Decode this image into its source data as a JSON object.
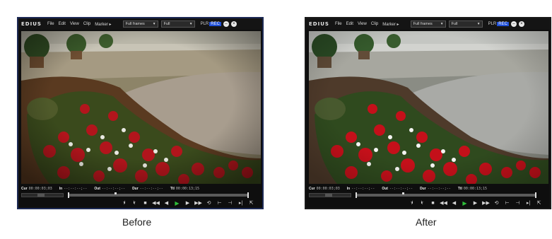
{
  "panels": {
    "before": {
      "logo": "EDIUS",
      "menu": [
        "File",
        "Edit",
        "View",
        "Clip",
        "Marker ▸"
      ],
      "dropdown_1": "Full frames",
      "dropdown_2": "Full",
      "plr_label": "PLR",
      "rec_label": "REC",
      "timecodes": [
        {
          "label": "Cur",
          "value": "00:00:03;03"
        },
        {
          "label": "In",
          "value": "--:--:--;--"
        },
        {
          "label": "Out",
          "value": "--:--:--;--"
        },
        {
          "label": "Dur",
          "value": "--:--:--;--"
        },
        {
          "label": "Ttl",
          "value": "00:00:13;15"
        }
      ],
      "caption": "Before"
    },
    "after": {
      "logo": "EDIUS",
      "menu": [
        "File",
        "Edit",
        "View",
        "Clip",
        "Marker ▸"
      ],
      "dropdown_1": "Full frames",
      "dropdown_2": "Full",
      "plr_label": "PLR",
      "rec_label": "REC",
      "timecodes": [
        {
          "label": "Cur",
          "value": "00:00:03;03"
        },
        {
          "label": "In",
          "value": "--:--:--;--"
        },
        {
          "label": "Out",
          "value": "--:--:--;--"
        },
        {
          "label": "Dur",
          "value": "--:--:--;--"
        },
        {
          "label": "Ttl",
          "value": "00:00:13;15"
        }
      ],
      "caption": "After"
    }
  },
  "colors": {
    "rec_accent": "#1f4fd6",
    "play_green": "#2fbf3a",
    "before_border": "#1d2a55"
  },
  "control_icons": [
    "mark-in-icon",
    "mark-out-icon",
    "stop-icon",
    "rewind-icon",
    "step-back-icon",
    "play-icon",
    "step-forward-icon",
    "fast-forward-icon",
    "loop-play-icon",
    "insert-icon",
    "overwrite-icon",
    "export-icon"
  ]
}
